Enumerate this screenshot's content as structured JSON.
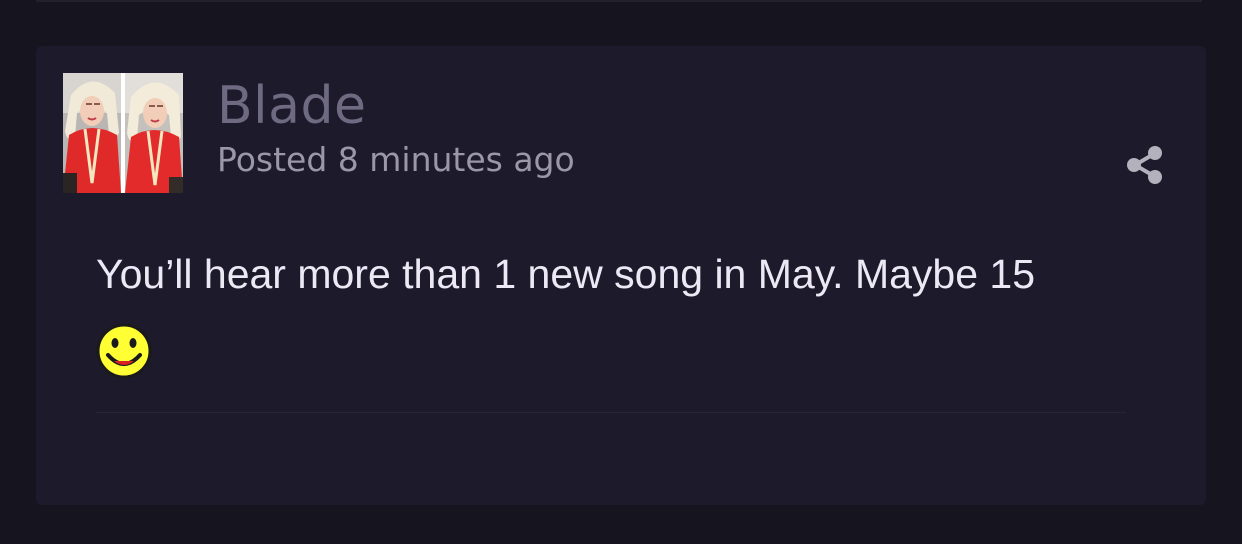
{
  "post": {
    "author": "Blade",
    "posted_time": "Posted 8 minutes ago",
    "body_text": "You’ll hear more than 1 new song in May. Maybe 15",
    "emoji": "smiley-emoji"
  },
  "icons": {
    "share": "share-icon",
    "avatar": "avatar-image"
  },
  "colors": {
    "page_background": "#16141f",
    "card_background": "#1d1a2c",
    "author_name": "#6f6a81",
    "timestamp": "#9b97a8",
    "body_text": "#ece9f5",
    "share_icon": "#b3b1bc",
    "emoji_yellow": "#ffff33"
  }
}
